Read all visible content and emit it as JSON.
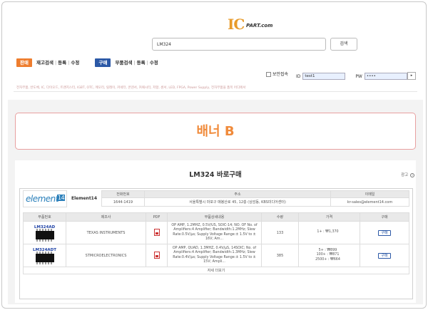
{
  "logo": {
    "ic": "IC",
    "part": "PART.com"
  },
  "search": {
    "value": "LM324",
    "button": "검색"
  },
  "sell": {
    "badge": "판매",
    "links": [
      "재고검색",
      "등록",
      "수정"
    ]
  },
  "buy": {
    "badge": "구매",
    "links": [
      "부품검색",
      "등록",
      "수정"
    ]
  },
  "login": {
    "save_id": "보안접속",
    "id_label": "ID",
    "id_value": "test1",
    "pw_label": "PW",
    "pw_value": "••••",
    "go": "▸"
  },
  "categories": "전자부품, 반도체, IC, 다이오드, 트랜지스터, IGBT, OTC, 메모리, 릴레이, 커넥터, 콘덴서, 커패시터, 저항, 센서, LED, FPGA, Power Supply, 전자부품을 품목 어디에서",
  "banner": "배너 B",
  "buy_section": {
    "title": "LM324 바로구매",
    "ad": "광고",
    "ad_icon": "i"
  },
  "distributor": {
    "logo": "element",
    "logo_num": "14",
    "name": "Element14",
    "headers": [
      "전화번호",
      "주소",
      "이메일"
    ],
    "phone": "1644-1419",
    "address": "서울특별시 마포구 매봉산로 45, 12층 (상암동, KBS미디어센터)",
    "email": "kr-sales@element14.com"
  },
  "parts_table": {
    "headers": [
      "부품번호",
      "제조사",
      "PDF",
      "부품상세내용",
      "수량",
      "가격",
      "구매"
    ],
    "rows": [
      {
        "part": "LM324AD",
        "mfr": "TEXAS INSTRUMENTS",
        "desc": "OP AMP, 1.2MHZ, 0.5V/US, SOIC-14; NO. OF No. of Amplifiers:4 Amplifier; Bandwidth:1.2MHz; Slew Rate:0.5V/μs; Supply Voltage Range:± 1.5V to ± 16V; Am...",
        "qty": "133",
        "price": "1+ : ₩1,370",
        "buy": "구매"
      },
      {
        "part": "LM324ADT",
        "mfr": "STMICROELECTRONICS",
        "desc": "OP AMP, QUAD, 1.3MHZ, 0.4V/μS, 14SOIC; No. of Amplifiers:4 Amplifier; Bandwidth:1.3MHz; Slew Rate:0.4V/μs; Supply Voltage Range:± 1.5V to ± 15V; Ampli...",
        "qty": "385",
        "price": "5+ : ₩899 | 100+ : ₩871 | 2500+ : ₩664",
        "buy": "구매"
      }
    ],
    "more": "자세 더보기"
  }
}
